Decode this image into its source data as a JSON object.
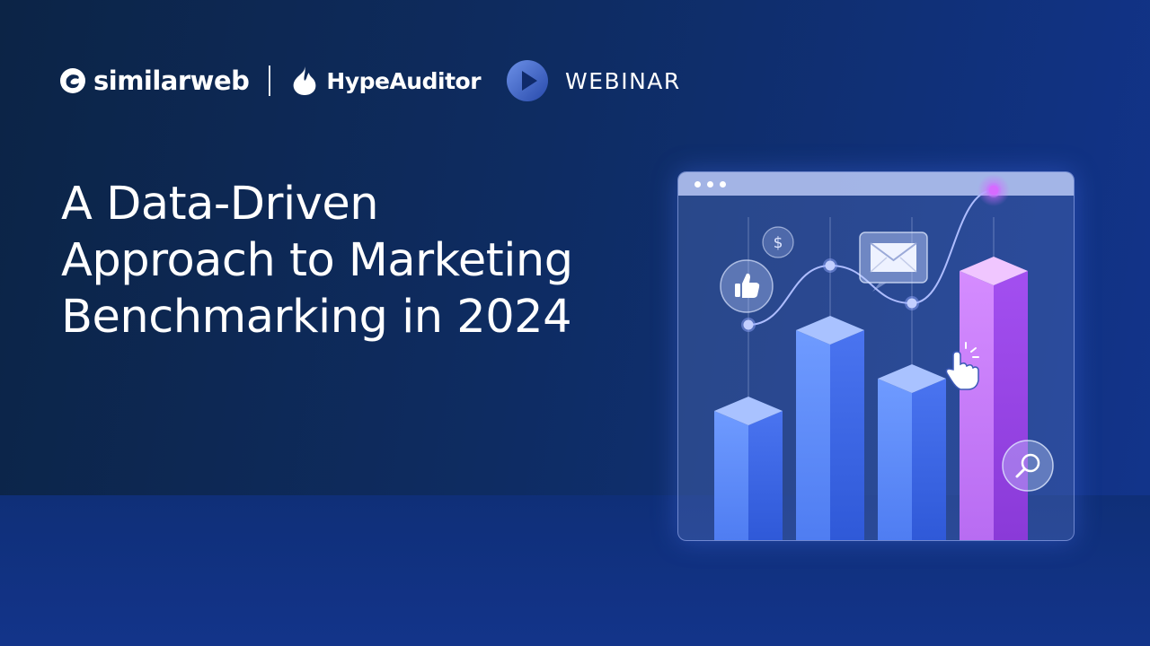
{
  "header": {
    "brand_primary": "similarweb",
    "brand_secondary": "HypeAuditor",
    "event_type": "WEBINAR"
  },
  "title_lines": [
    "A Data-Driven",
    "Approach to Marketing",
    "Benchmarking in 2024"
  ],
  "illustration": {
    "icons": [
      "thumbs-up-icon",
      "dollar-icon",
      "mail-icon",
      "cursor-click-icon",
      "magnifier-icon"
    ],
    "dollar_symbol": "$",
    "colors": {
      "bar_blue": "#5b8cff",
      "bar_purple": "#b35cf7",
      "line": "#aebdff",
      "accent": "#c45cff"
    }
  },
  "chart_data": {
    "type": "bar",
    "categories": [
      "",
      "",
      "",
      ""
    ],
    "values": [
      120,
      195,
      150,
      250
    ],
    "series_line": [
      200,
      255,
      220,
      325
    ],
    "highlight_index": 3
  }
}
